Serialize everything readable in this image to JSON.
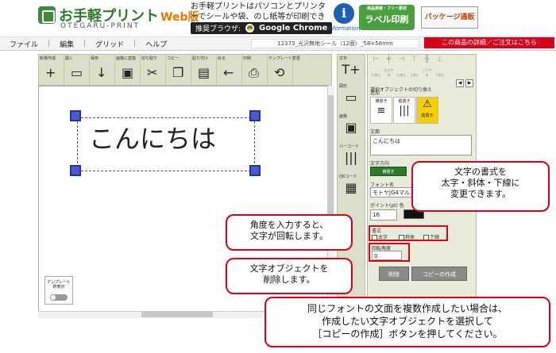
{
  "header": {
    "logo_title": "お手軽プリント",
    "logo_web": "Web版",
    "logo_sub": "OTEGARU-PRINT",
    "intro": "お手軽プリントはパソコンとプリンターでシールや袋、のし紙等が印刷できます。",
    "browser_label": "推奨ブラウザ:",
    "browser_name": "Google Chrome",
    "info_icon": "i",
    "info_label": "Information",
    "label_logo_small": "商品検索・フリー素材",
    "label_logo": "ラベル印刷",
    "package_logo": "パッケージ通販"
  },
  "menu": {
    "items": [
      "ファイル",
      "編集",
      "グリッド",
      "ヘルプ"
    ],
    "separator": "|",
    "doc_name": "12373_光沢無地シール（12面）_58×58mm",
    "detail_button": "この商品の詳細／ご注文はこちら"
  },
  "toolbar": [
    {
      "label": "新規作成",
      "icon": "+"
    },
    {
      "label": "開く",
      "icon": "▭"
    },
    {
      "label": "保存",
      "icon": "↓"
    },
    {
      "label": "画像に変換",
      "icon": "▣"
    },
    {
      "label": "切り取り",
      "icon": "✂"
    },
    {
      "label": "コピー",
      "icon": "❐"
    },
    {
      "label": "貼り付け",
      "icon": "▤"
    },
    {
      "label": "戻る",
      "icon": "←"
    },
    {
      "label": "印刷",
      "icon": "⎙"
    },
    {
      "label": "テンプレート変更",
      "icon": "⟲"
    }
  ],
  "canvas": {
    "text": "こんにちは",
    "template_label": "テンプレート枠表示"
  },
  "tool_column": [
    {
      "label": "文字",
      "icon": "T+"
    },
    {
      "label": "図形",
      "icon": "▭"
    },
    {
      "label": "画像",
      "icon": "▣"
    },
    {
      "label": "バーコード",
      "icon": "|||"
    },
    {
      "label": "QRコード",
      "icon": "▦"
    }
  ],
  "panel": {
    "align_labels": [
      "左揃え",
      "左右中央",
      "右揃え",
      "上揃え",
      "上下中央",
      "下揃え"
    ],
    "switch_label": "選択オブジェクトの切り換え",
    "switch_prev": "◀",
    "switch_next": "▶",
    "add_label": "追加",
    "dir_buttons": [
      {
        "label": "横書き",
        "icon": "≡"
      },
      {
        "label": "縦書き",
        "icon": "|||"
      },
      {
        "label": "縦書き",
        "icon": "⚠"
      }
    ],
    "text_label": "文面",
    "text_value": "こんにちは",
    "direction_label": "文字方向",
    "direction_value": "横書き",
    "font_label": "フォント名",
    "font_value": "モトヤJG4マル",
    "point_label": "ポイント(pt) 色",
    "point_value": "16",
    "style_label": "書式",
    "bold_label": "太字",
    "italic_label": "斜体",
    "underline_label": "下線",
    "rotation_label": "回転角度",
    "rotation_value": "0",
    "delete_button": "削除",
    "copy_button": "コピーの作成"
  },
  "callouts": {
    "style": "文字の書式を\n太字・斜体・下線に\n変更できます。",
    "rotation": "角度を入力すると、\n文字が回転します。",
    "delete": "文字オブジェクトを\n削除します。",
    "copy": "同じフォントの文面を複数作成したい場合は、\n作成したい文字オブジェクトを選択して\n［コピーの作成］ボタンを押してください。"
  }
}
